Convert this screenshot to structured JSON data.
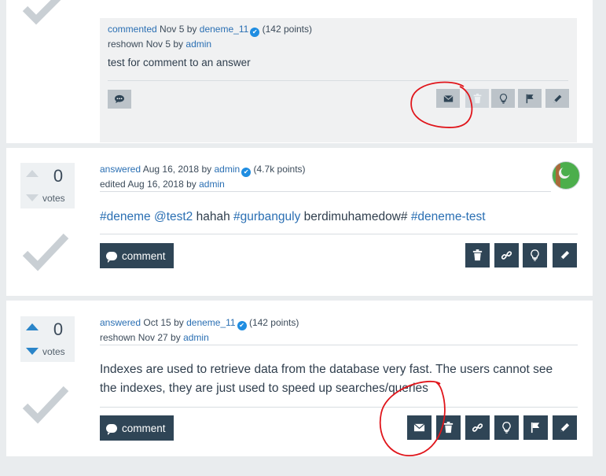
{
  "verified_glyph": "✔",
  "top_card": {
    "comment": {
      "action": "commented",
      "date": "Nov 5",
      "by": "by",
      "user": "deneme_11",
      "points": "(142 points)",
      "reshown_prefix": "reshown Nov 5 by",
      "reshown_user": "admin",
      "text": "test for comment to an answer"
    }
  },
  "answer1": {
    "votes": "0",
    "votes_label": "votes",
    "meta_action": "answered",
    "meta_date": "Aug 16, 2018",
    "meta_by": "by",
    "meta_user": "admin",
    "meta_points": "(4.7k points)",
    "edited_prefix": "edited Aug 16, 2018 by",
    "edited_user": "admin",
    "body": {
      "tag1": "#deneme",
      "tag2": "@test2",
      "word1": "hahah",
      "tag3": "#gurbanguly",
      "word2": "berdimuhamedow#",
      "tag4": "#deneme-test"
    },
    "comment_button": "comment"
  },
  "answer2": {
    "votes": "0",
    "votes_label": "votes",
    "meta_action": "answered",
    "meta_date": "Oct 15",
    "meta_by": "by",
    "meta_user": "deneme_11",
    "meta_points": "(142 points)",
    "reshown_prefix": "reshown Nov 27 by",
    "reshown_user": "admin",
    "body_line1": "Indexes are used to retrieve data from the database very fast. The users cannot see",
    "body_line2": "the indexes, they are just used to speed up searches/queries",
    "comment_button": "comment"
  },
  "colors": {
    "button_dark": "#2f4556",
    "link": "#2a6fb3",
    "vote_active": "#2a85c9",
    "annotation_red": "#e0151b"
  },
  "icons": [
    "reply-icon",
    "envelope-icon",
    "trash-icon",
    "link-icon",
    "lightbulb-icon",
    "flag-icon",
    "pencil-icon",
    "checkmark-icon"
  ]
}
